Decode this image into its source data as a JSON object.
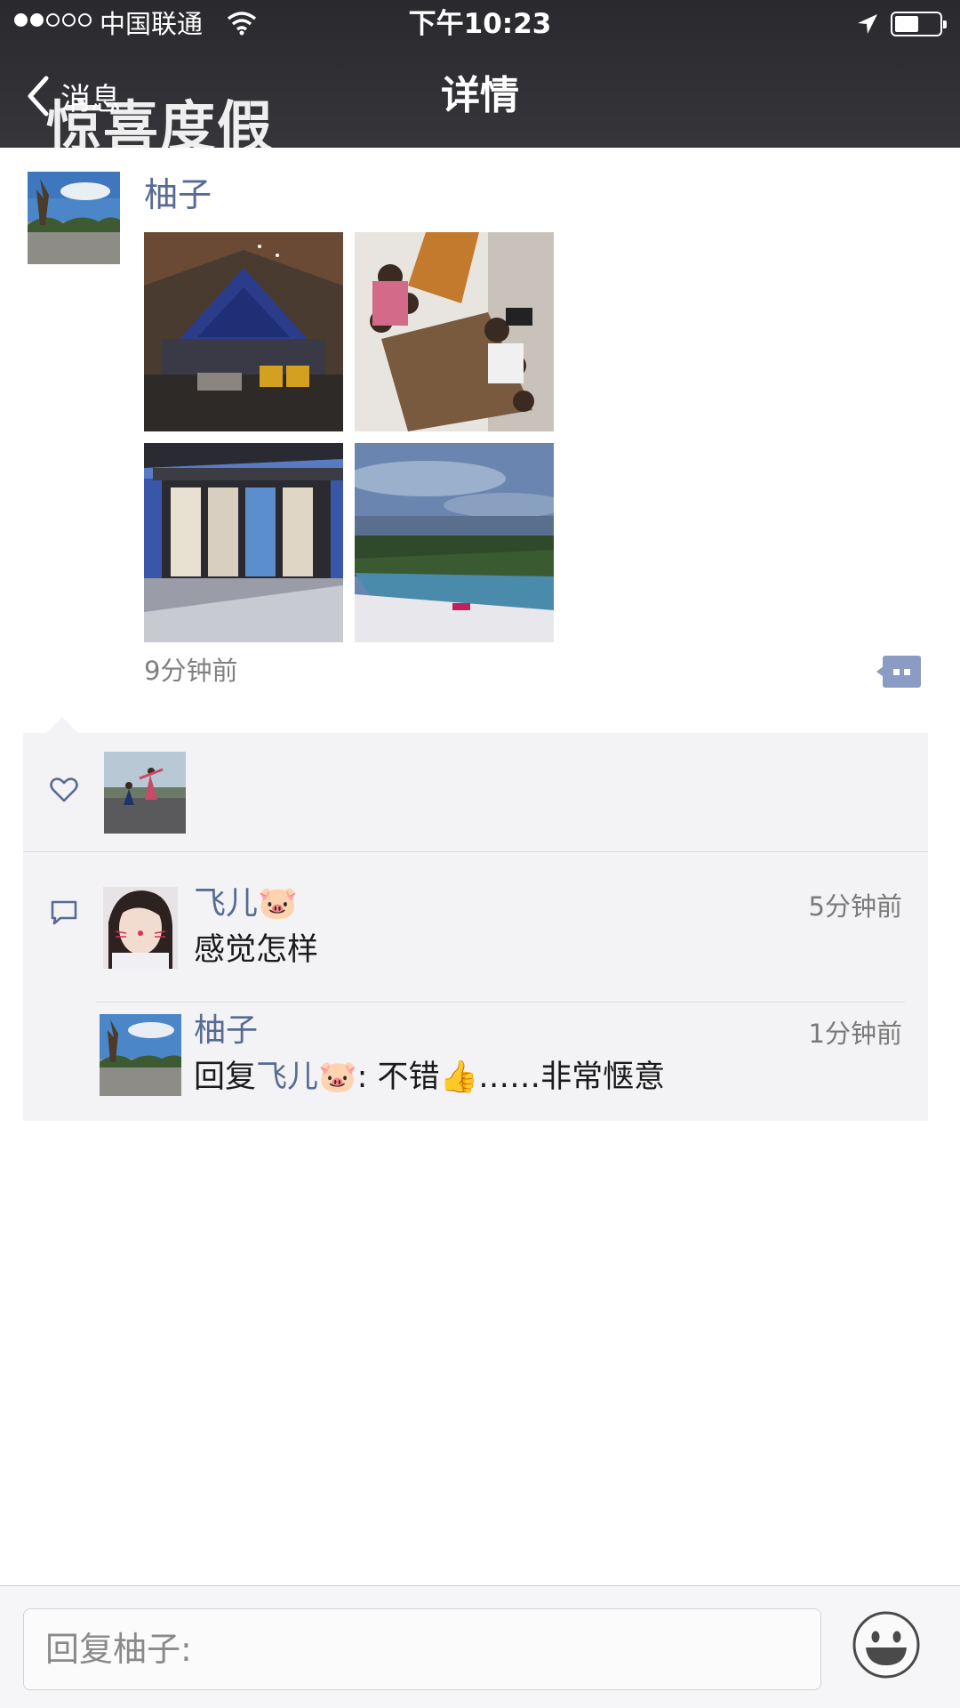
{
  "status_bar": {
    "carrier": "中国联通",
    "time": "下午10:23"
  },
  "nav": {
    "back_label": "消息",
    "title": "详情",
    "watermark": "惊喜度假"
  },
  "post": {
    "author": "柚子",
    "photos": [
      "villa-interior",
      "group-dinner",
      "villa-exterior",
      "infinity-pool"
    ],
    "time": "9分钟前"
  },
  "likes": {
    "avatars": [
      "liker-avatar"
    ]
  },
  "comments": [
    {
      "name": "飞儿🐷",
      "time": "5分钟前",
      "text": "感觉怎样"
    },
    {
      "name": "柚子",
      "time": "1分钟前",
      "reply_prefix": "回复",
      "reply_to": "飞儿🐷",
      "text": ": 不错👍……非常惬意"
    }
  ],
  "reply_bar": {
    "placeholder": "回复柚子:"
  },
  "colors": {
    "link": "#576b95",
    "navbar": "#303034",
    "comment_bg": "#f3f3f5"
  }
}
